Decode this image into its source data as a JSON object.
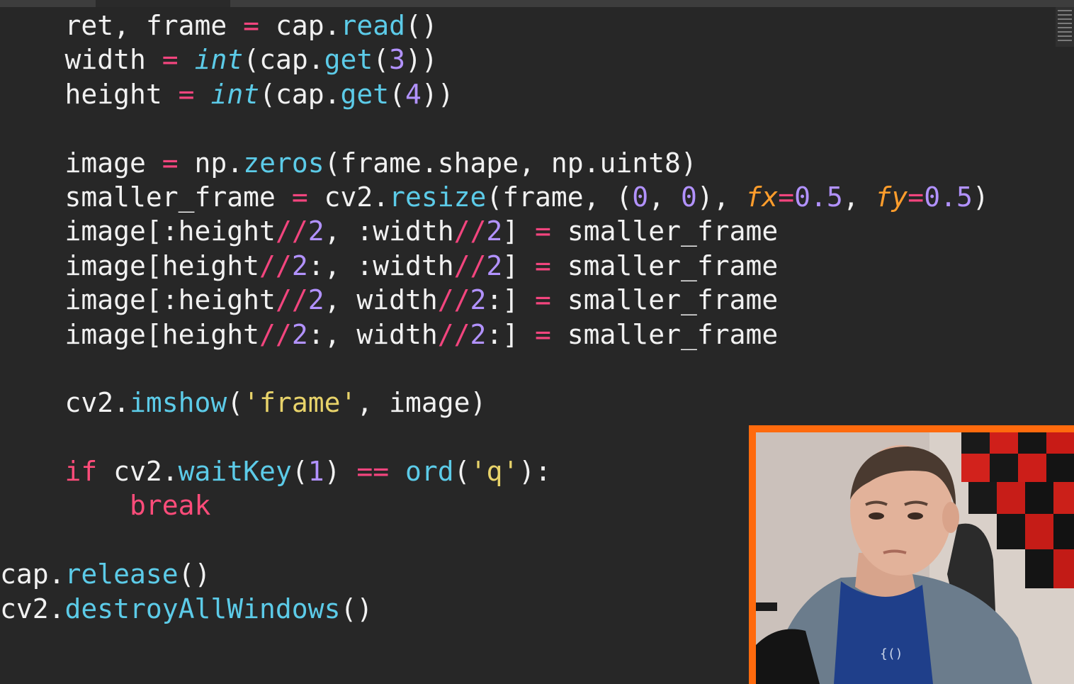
{
  "editor": {
    "language": "python",
    "lines": [
      [
        {
          "c": "t",
          "v": "    ret, frame "
        },
        {
          "c": "o",
          "v": "="
        },
        {
          "c": "t",
          "v": " cap."
        },
        {
          "c": "f",
          "v": "read"
        },
        {
          "c": "t",
          "v": "()"
        }
      ],
      [
        {
          "c": "t",
          "v": "    width "
        },
        {
          "c": "o",
          "v": "="
        },
        {
          "c": "t",
          "v": " "
        },
        {
          "c": "bi",
          "v": "int"
        },
        {
          "c": "t",
          "v": "(cap."
        },
        {
          "c": "f",
          "v": "get"
        },
        {
          "c": "t",
          "v": "("
        },
        {
          "c": "n",
          "v": "3"
        },
        {
          "c": "t",
          "v": "))"
        }
      ],
      [
        {
          "c": "t",
          "v": "    height "
        },
        {
          "c": "o",
          "v": "="
        },
        {
          "c": "t",
          "v": " "
        },
        {
          "c": "bi",
          "v": "int"
        },
        {
          "c": "t",
          "v": "(cap."
        },
        {
          "c": "f",
          "v": "get"
        },
        {
          "c": "t",
          "v": "("
        },
        {
          "c": "n",
          "v": "4"
        },
        {
          "c": "t",
          "v": "))"
        }
      ],
      [],
      [
        {
          "c": "t",
          "v": "    image "
        },
        {
          "c": "o",
          "v": "="
        },
        {
          "c": "t",
          "v": " np."
        },
        {
          "c": "f",
          "v": "zeros"
        },
        {
          "c": "t",
          "v": "(frame.shape, np.uint8)"
        }
      ],
      [
        {
          "c": "t",
          "v": "    smaller_frame "
        },
        {
          "c": "o",
          "v": "="
        },
        {
          "c": "t",
          "v": " cv2."
        },
        {
          "c": "f",
          "v": "resize"
        },
        {
          "c": "t",
          "v": "(frame, ("
        },
        {
          "c": "n",
          "v": "0"
        },
        {
          "c": "t",
          "v": ", "
        },
        {
          "c": "n",
          "v": "0"
        },
        {
          "c": "t",
          "v": "), "
        },
        {
          "c": "p",
          "v": "fx"
        },
        {
          "c": "o",
          "v": "="
        },
        {
          "c": "n",
          "v": "0.5"
        },
        {
          "c": "t",
          "v": ", "
        },
        {
          "c": "p",
          "v": "fy"
        },
        {
          "c": "o",
          "v": "="
        },
        {
          "c": "n",
          "v": "0.5"
        },
        {
          "c": "t",
          "v": ")"
        }
      ],
      [
        {
          "c": "t",
          "v": "    image[:height"
        },
        {
          "c": "o",
          "v": "//"
        },
        {
          "c": "n",
          "v": "2"
        },
        {
          "c": "t",
          "v": ", :width"
        },
        {
          "c": "o",
          "v": "//"
        },
        {
          "c": "n",
          "v": "2"
        },
        {
          "c": "t",
          "v": "] "
        },
        {
          "c": "o",
          "v": "="
        },
        {
          "c": "t",
          "v": " smaller_frame"
        }
      ],
      [
        {
          "c": "t",
          "v": "    image[height"
        },
        {
          "c": "o",
          "v": "//"
        },
        {
          "c": "n",
          "v": "2"
        },
        {
          "c": "t",
          "v": ":, :width"
        },
        {
          "c": "o",
          "v": "//"
        },
        {
          "c": "n",
          "v": "2"
        },
        {
          "c": "t",
          "v": "] "
        },
        {
          "c": "o",
          "v": "="
        },
        {
          "c": "t",
          "v": " smaller_frame"
        }
      ],
      [
        {
          "c": "t",
          "v": "    image[:height"
        },
        {
          "c": "o",
          "v": "//"
        },
        {
          "c": "n",
          "v": "2"
        },
        {
          "c": "t",
          "v": ", width"
        },
        {
          "c": "o",
          "v": "//"
        },
        {
          "c": "n",
          "v": "2"
        },
        {
          "c": "t",
          "v": ":] "
        },
        {
          "c": "o",
          "v": "="
        },
        {
          "c": "t",
          "v": " smaller_frame"
        }
      ],
      [
        {
          "c": "t",
          "v": "    image[height"
        },
        {
          "c": "o",
          "v": "//"
        },
        {
          "c": "n",
          "v": "2"
        },
        {
          "c": "t",
          "v": ":, width"
        },
        {
          "c": "o",
          "v": "//"
        },
        {
          "c": "n",
          "v": "2"
        },
        {
          "c": "t",
          "v": ":] "
        },
        {
          "c": "o",
          "v": "="
        },
        {
          "c": "t",
          "v": " smaller_frame"
        }
      ],
      [],
      [
        {
          "c": "t",
          "v": "    cv2."
        },
        {
          "c": "f",
          "v": "imshow"
        },
        {
          "c": "t",
          "v": "("
        },
        {
          "c": "s",
          "v": "'frame'"
        },
        {
          "c": "t",
          "v": ", image)"
        }
      ],
      [],
      [
        {
          "c": "t",
          "v": "    "
        },
        {
          "c": "k",
          "v": "if"
        },
        {
          "c": "t",
          "v": " cv2."
        },
        {
          "c": "f",
          "v": "waitKey"
        },
        {
          "c": "t",
          "v": "("
        },
        {
          "c": "n",
          "v": "1"
        },
        {
          "c": "t",
          "v": ") "
        },
        {
          "c": "o",
          "v": "=="
        },
        {
          "c": "t",
          "v": " "
        },
        {
          "c": "f",
          "v": "ord"
        },
        {
          "c": "t",
          "v": "("
        },
        {
          "c": "s",
          "v": "'q'"
        },
        {
          "c": "t",
          "v": "):"
        }
      ],
      [
        {
          "c": "t",
          "v": "        "
        },
        {
          "c": "k",
          "v": "break"
        }
      ],
      [],
      [
        {
          "c": "t",
          "v": "cap."
        },
        {
          "c": "f",
          "v": "release"
        },
        {
          "c": "t",
          "v": "()"
        }
      ],
      [
        {
          "c": "t",
          "v": "cv2."
        },
        {
          "c": "f",
          "v": "destroyAllWindows"
        },
        {
          "c": "t",
          "v": "()"
        }
      ]
    ]
  },
  "colors": {
    "background": "#272727",
    "keyword": "#ff4c7a",
    "function": "#5ccbe8",
    "number": "#b292ff",
    "string": "#e8d36a",
    "parameter": "#ff9d2c",
    "webcam_border": "#ff6a0d"
  },
  "webcam": {
    "icon": "webcam-person-image"
  }
}
